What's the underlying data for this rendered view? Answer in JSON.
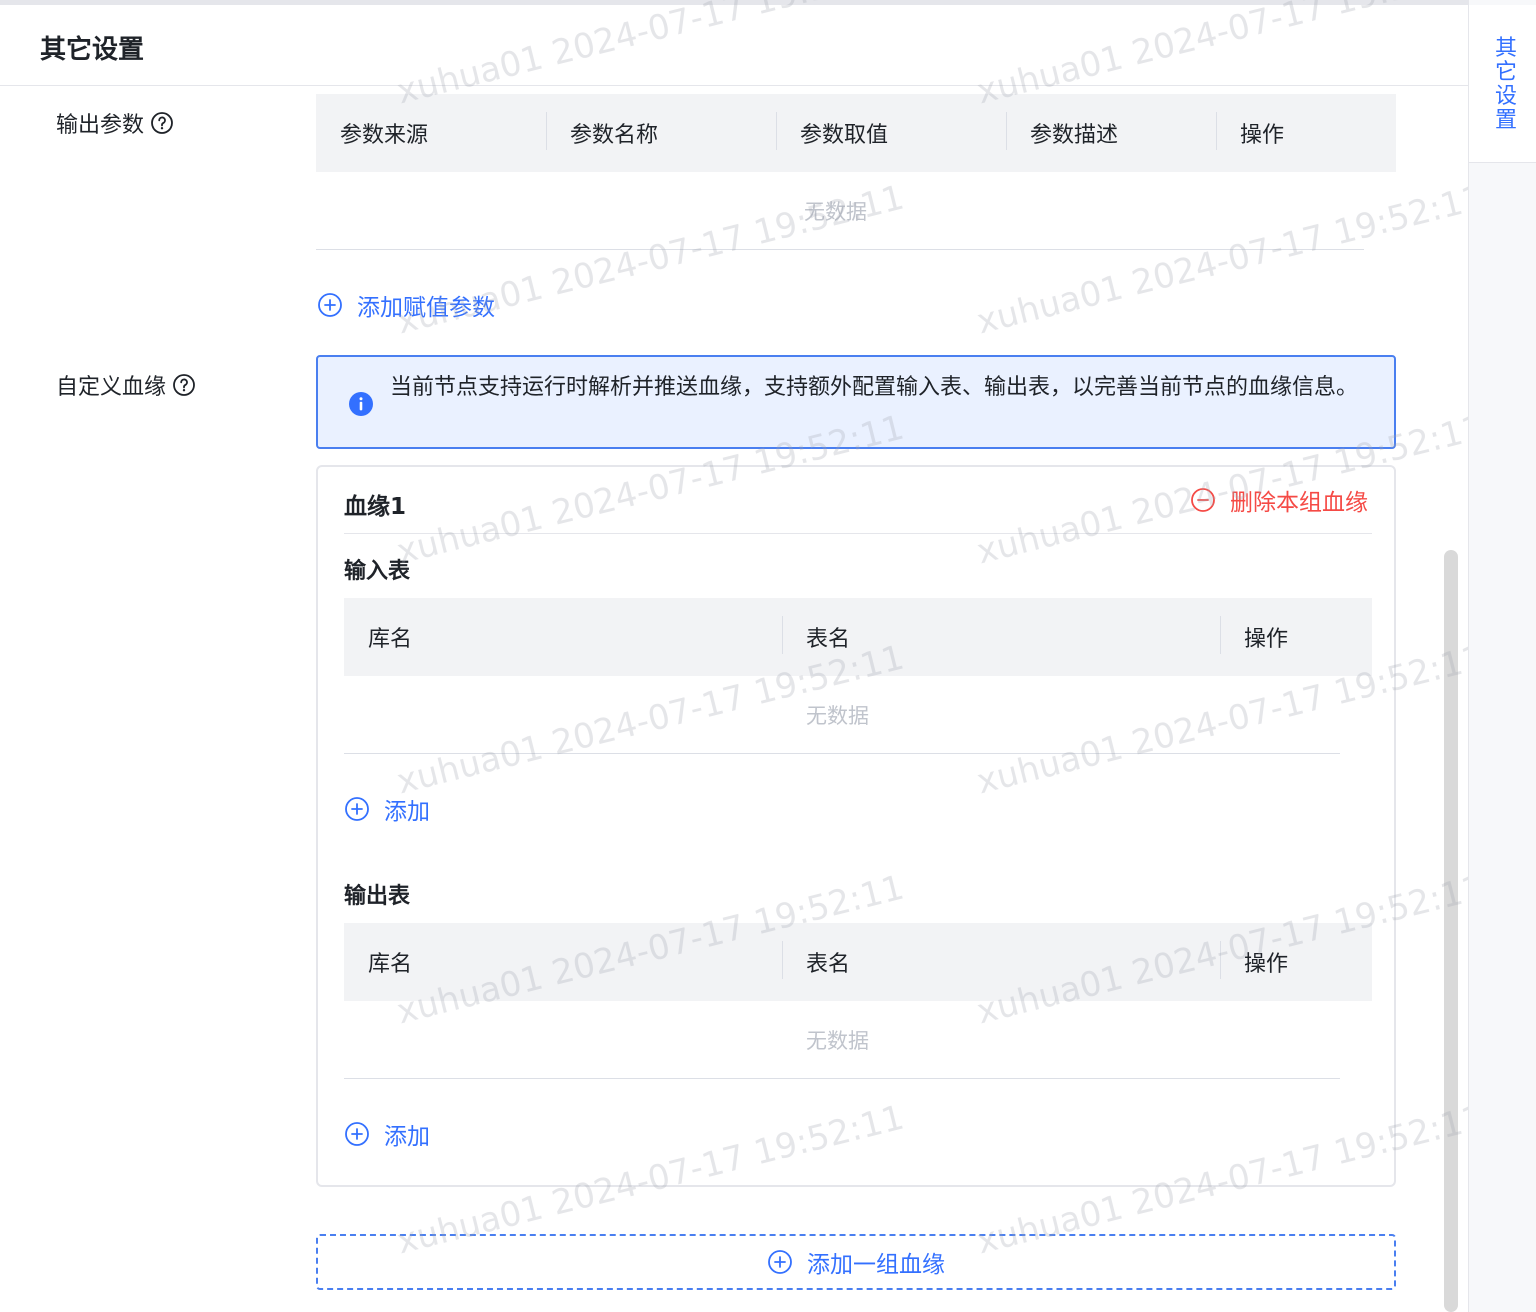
{
  "header": {
    "title": "其它设置"
  },
  "right_tab": {
    "label": "其它设置"
  },
  "output_params": {
    "label": "输出参数",
    "columns": [
      "参数来源",
      "参数名称",
      "参数取值",
      "参数描述",
      "操作"
    ],
    "empty_text": "无数据",
    "add_label": "添加赋值参数"
  },
  "lineage": {
    "label": "自定义血缘",
    "info_text": "当前节点支持运行时解析并推送血缘，支持额外配置输入表、输出表，以完善当前节点的血缘信息。",
    "group": {
      "title": "血缘1",
      "delete_label": "删除本组血缘",
      "input_table": {
        "title": "输入表",
        "columns": [
          "库名",
          "表名",
          "操作"
        ],
        "empty_text": "无数据",
        "add_label": "添加"
      },
      "output_table": {
        "title": "输出表",
        "columns": [
          "库名",
          "表名",
          "操作"
        ],
        "empty_text": "无数据",
        "add_label": "添加"
      }
    },
    "add_group_label": "添加一组血缘"
  },
  "watermark": {
    "text": "xuhua01 2024-07-17 19:52:11"
  },
  "colors": {
    "primary": "#3370ff",
    "danger": "#f54a45",
    "header_bg": "#f2f3f5",
    "info_bg": "#eaf1ff"
  },
  "icons": {
    "help": "question-circle-icon",
    "add": "plus-circle-icon",
    "remove": "minus-circle-icon",
    "info": "info-circle-icon"
  }
}
